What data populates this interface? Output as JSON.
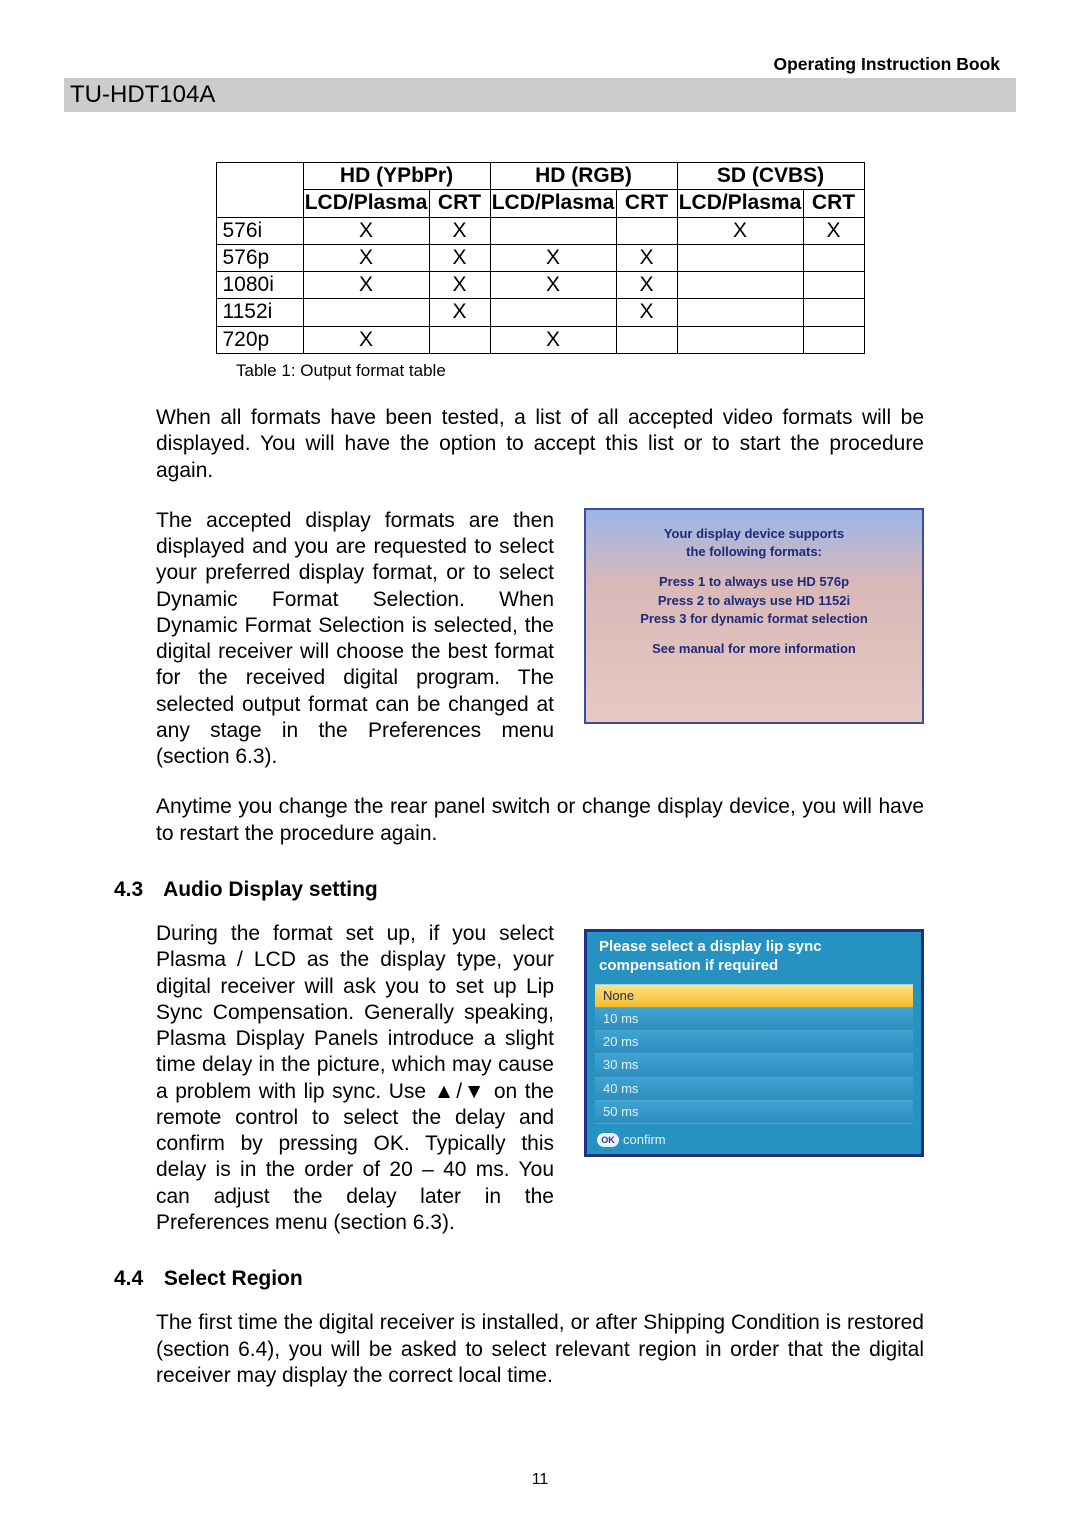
{
  "header": {
    "book_label": "Operating Instruction Book",
    "model": "TU-HDT104A"
  },
  "chart_data": {
    "type": "table",
    "title": "Output format table",
    "caption": "Table 1: Output format table",
    "column_groups": [
      "HD (YPbPr)",
      "HD (RGB)",
      "SD (CVBS)"
    ],
    "sub_columns": [
      "LCD/Plasma",
      "CRT"
    ],
    "rows": [
      {
        "label": "576i",
        "cells": [
          "X",
          "X",
          "",
          "",
          "X",
          "X"
        ]
      },
      {
        "label": "576p",
        "cells": [
          "X",
          "X",
          "X",
          "X",
          "",
          ""
        ]
      },
      {
        "label": "1080i",
        "cells": [
          "X",
          "X",
          "X",
          "X",
          "",
          ""
        ]
      },
      {
        "label": "1152i",
        "cells": [
          "",
          "X",
          "",
          "X",
          "",
          ""
        ]
      },
      {
        "label": "720p",
        "cells": [
          "X",
          "",
          "X",
          "",
          "",
          ""
        ]
      }
    ]
  },
  "paragraphs": {
    "after_table": "When all formats have been tested, a list of all accepted video formats will be displayed.  You will have the option to accept this list or to start the procedure again.",
    "accepted_formats": "The accepted display formats are then displayed and you are requested to select your preferred display format, or to select Dynamic Format Selection.  When Dynamic Format Selection is selected, the digital receiver will choose the best format for the received digital program.  The selected output format can be changed at any stage in the Preferences menu (section 6.3).",
    "restart_note": " Anytime you change the rear panel switch or change display device, you will have to restart the procedure again.",
    "audio_display": "During the format set up, if you select Plasma / LCD as the display type, your digital receiver will ask you to set up Lip Sync Compensation.  Generally speaking, Plasma Display Panels introduce a slight time delay in the picture, which may cause a problem with lip sync.  Use ▲/▼ on the remote control to select the delay and confirm by pressing OK.   Typically this delay is in the order of 20 – 40 ms.  You can adjust the delay later in the Preferences menu (section 6.3).",
    "select_region": "The first time the digital receiver is installed, or after Shipping Condition is restored (section 6.4), you will be asked to select relevant region in order that the digital receiver may display the correct local time."
  },
  "osd_formats": {
    "title1": "Your display device supports",
    "title2": "the following formats:",
    "line1": "Press 1 to always use HD 576p",
    "line2": "Press 2 to always use HD 1152i",
    "line3": "Press 3 for dynamic format selection",
    "footer": "See manual for more information"
  },
  "osd_lipsync": {
    "prompt": "Please select a display lip sync compensation if required",
    "options": [
      "None",
      "10 ms",
      "20 ms",
      "30 ms",
      "40 ms",
      "50 ms"
    ],
    "selected_index": 0,
    "ok_label": "OK",
    "confirm_label": "confirm"
  },
  "sections": {
    "s43_num": "4.3",
    "s43_title": "Audio Display setting",
    "s44_num": "4.4",
    "s44_title": "Select Region"
  },
  "page_number": "11"
}
